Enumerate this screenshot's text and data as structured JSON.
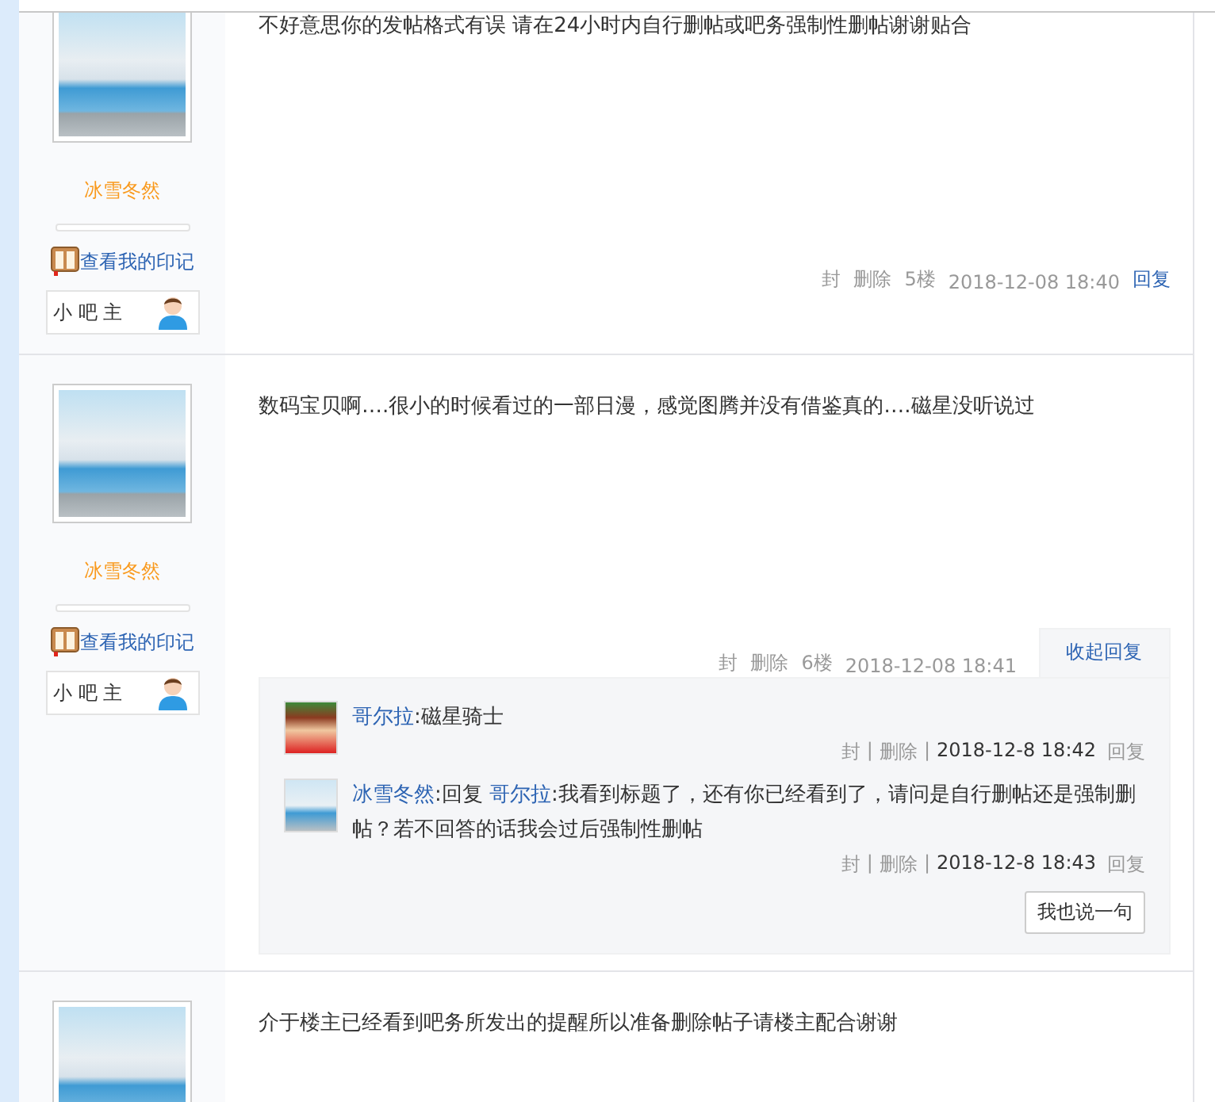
{
  "posts": [
    {
      "user": {
        "name": "冰雪冬然",
        "link": "查看我的印记",
        "badge": "小 吧 主"
      },
      "content": "不好意思你的发帖格式有误 请在24小时内自行删帖或吧务强制性删帖谢谢贴合",
      "footer": {
        "block": "封",
        "delete": "删除",
        "floor": "5楼",
        "time": "2018-12-08 18:40",
        "reply": "回复"
      }
    },
    {
      "user": {
        "name": "冰雪冬然",
        "link": "查看我的印记",
        "badge": "小 吧 主"
      },
      "content": "数码宝贝啊….很小的时候看过的一部日漫，感觉图腾并没有借鉴真的….磁星没听说过",
      "footer": {
        "block": "封",
        "delete": "删除",
        "floor": "6楼",
        "time": "2018-12-08 18:41",
        "toggle": "收起回复"
      },
      "replies": [
        {
          "kind": "cartoon",
          "author": "哥尔拉",
          "colon": ":",
          "text": "磁星骑士",
          "meta": {
            "block": "封",
            "separators": [
              "|",
              "|"
            ],
            "delete": "删除",
            "time": "2018-12-8 18:42",
            "reply": "回复"
          }
        },
        {
          "kind": "photo",
          "author": "冰雪冬然",
          "colon": ":",
          "reply_prefix": "回复",
          "mention": "哥尔拉",
          "text": ":我看到标题了，还有你已经看到了，请问是自行删帖还是强制删帖？若不回答的话我会过后强制性删帖",
          "meta": {
            "block": "封",
            "separators": [
              "|",
              "|"
            ],
            "delete": "删除",
            "time": "2018-12-8 18:43",
            "reply": "回复"
          }
        }
      ],
      "say_button": "我也说一句"
    },
    {
      "content": "介于楼主已经看到吧务所发出的提醒所以准备删除帖子请楼主配合谢谢"
    }
  ]
}
